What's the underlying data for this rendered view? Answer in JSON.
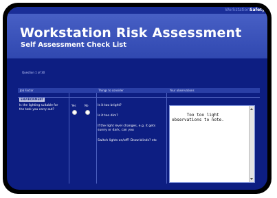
{
  "brand": {
    "part1": "Workstation",
    "part2": "Safety"
  },
  "header": {
    "title": "Workstation Risk Assessment",
    "subtitle": "Self Assessment Check List"
  },
  "question_counter": "Question 1 of 30",
  "columns": [
    "Job Factor",
    "Things to consider",
    "Your observations"
  ],
  "section_label": "ENVIRONMENT",
  "question": "Is the lighting suitable for the task you carry out?",
  "answer_options": [
    "Yes",
    "No"
  ],
  "considerations": [
    "Is it too bright?",
    "Is it too dim?",
    "If the light level changes, e.g. it gets sunny or dark, can you",
    "Switch lights on/off? Draw blinds? etc"
  ],
  "observation_value": "Too too light\nobservations to note.",
  "colors": {
    "background": "#0d1e82",
    "header": "#3a52ba",
    "frame": "#000000"
  }
}
